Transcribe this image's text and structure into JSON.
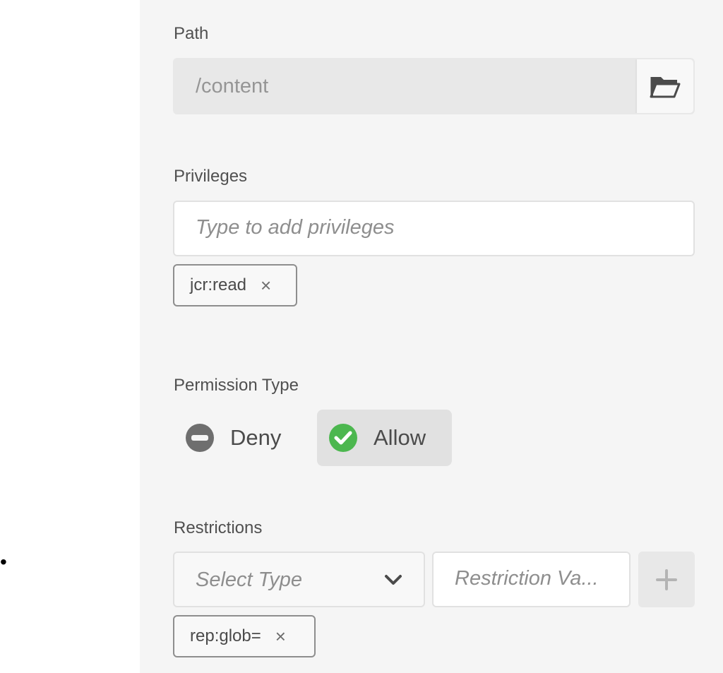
{
  "path": {
    "label": "Path",
    "value": "/content",
    "browse_icon": "folder-open-icon"
  },
  "privileges": {
    "label": "Privileges",
    "placeholder": "Type to add privileges",
    "tags": [
      {
        "label": "jcr:read",
        "remove": "×"
      }
    ]
  },
  "permission_type": {
    "label": "Permission Type",
    "options": [
      {
        "label": "Deny",
        "icon": "minus-circle-icon",
        "selected": false,
        "color": "#6e6e6e"
      },
      {
        "label": "Allow",
        "icon": "checkmark-circle-icon",
        "selected": true,
        "color": "#4cb74f"
      }
    ]
  },
  "restrictions": {
    "label": "Restrictions",
    "select_placeholder": "Select Type",
    "value_placeholder": "Restriction Va...",
    "add_icon": "plus-icon",
    "tags": [
      {
        "label": "rep:glob=",
        "remove": "×"
      }
    ]
  },
  "bullet": "•"
}
